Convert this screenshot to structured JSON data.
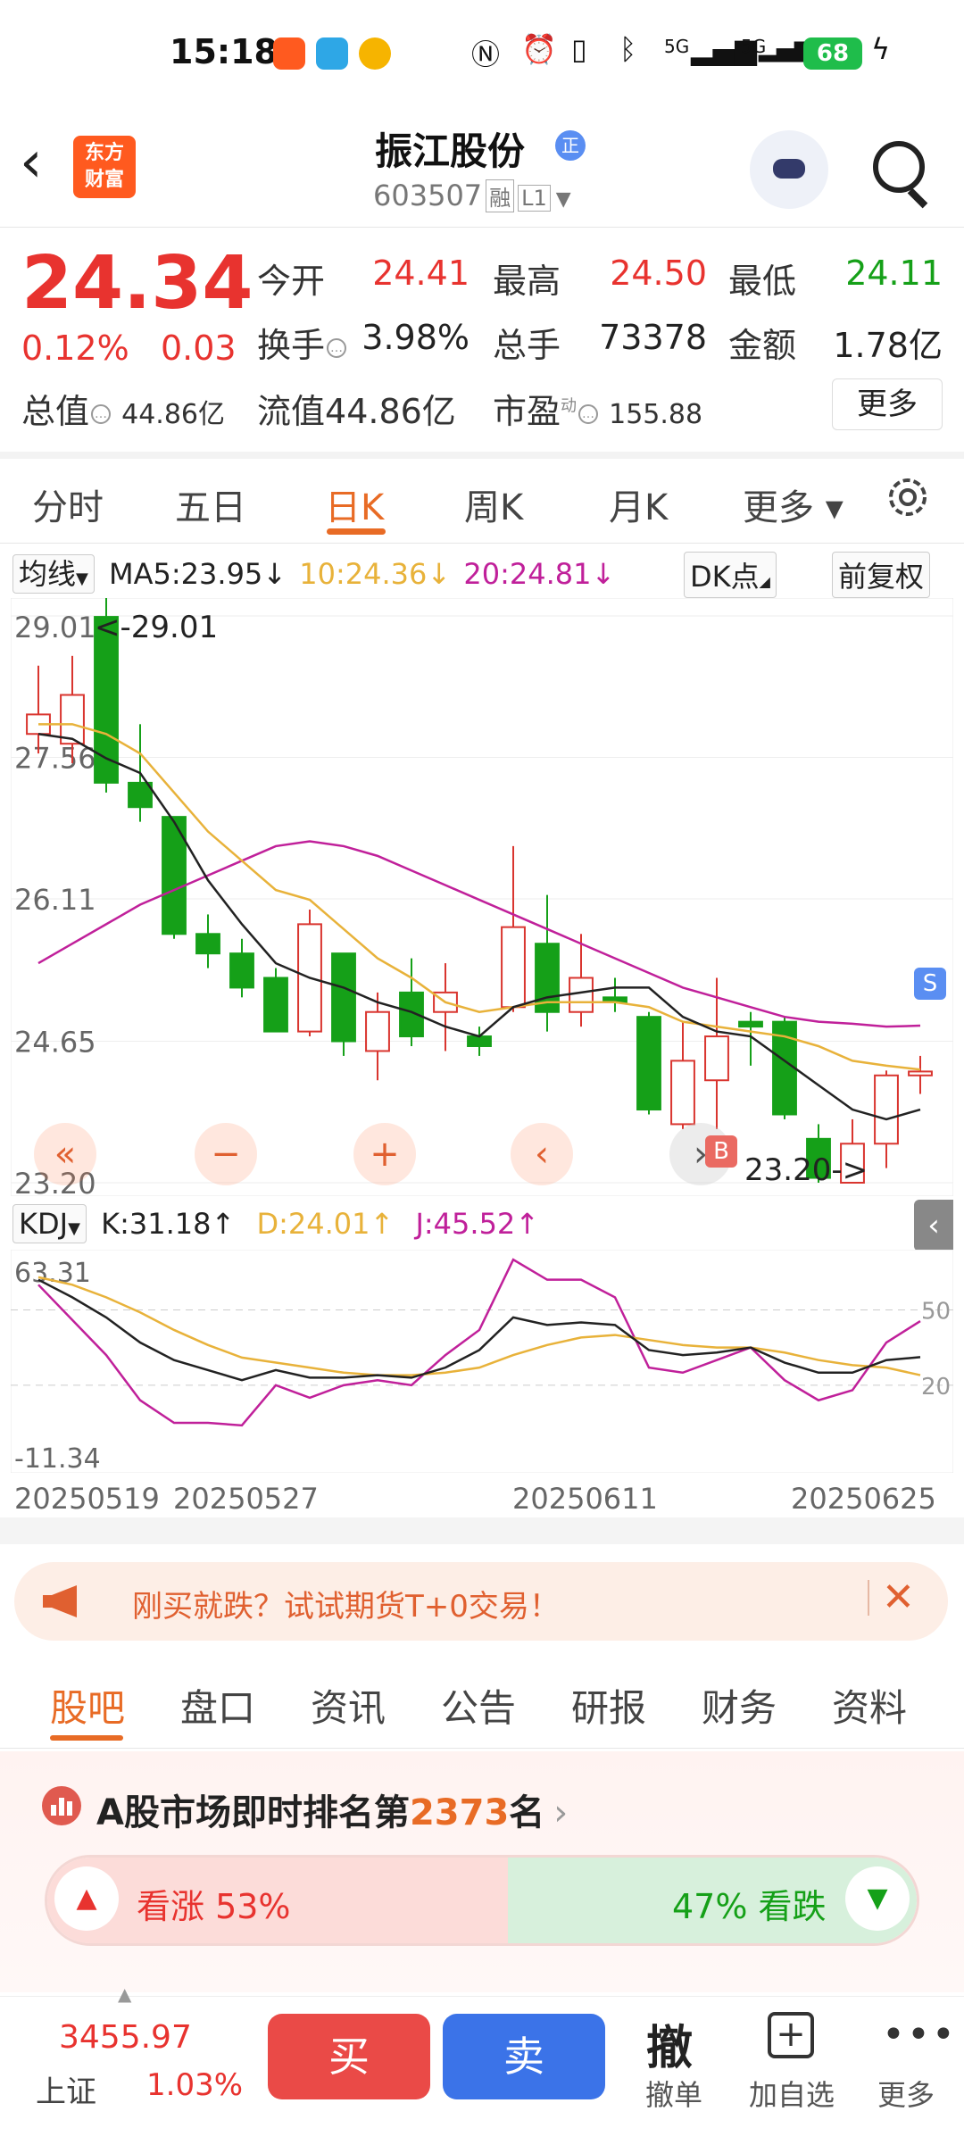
{
  "status_bar": {
    "time": "15:18",
    "battery": "68",
    "signal1": "5G",
    "signal2": "5G"
  },
  "header": {
    "stock_name": "振江股份",
    "name_badge": "正",
    "stock_code": "603507",
    "tag_margin": "融",
    "tag_level": "L1",
    "logo_line1": "东方",
    "logo_line2": "财富"
  },
  "quote": {
    "price": "24.34",
    "change_pct": "0.12%",
    "change_abs": "0.03",
    "open_label": "今开",
    "open": "24.41",
    "high_label": "最高",
    "high": "24.50",
    "low_label": "最低",
    "low": "24.11",
    "turnover_label": "换手",
    "turnover": "3.98%",
    "volume_label": "总手",
    "volume": "73378",
    "amount_label": "金额",
    "amount": "1.78亿",
    "mcap_label": "总值",
    "mcap": "44.86亿",
    "float_label": "流值",
    "float": "44.86亿",
    "pe_label": "市盈",
    "pe_sup": "动",
    "pe": "155.88",
    "more": "更多"
  },
  "period_tabs": [
    "分时",
    "五日",
    "日K",
    "周K",
    "月K",
    "更多"
  ],
  "ma_bar": {
    "selector": "均线",
    "ma5": "MA5:23.95↓",
    "ma10": "10:24.36↓",
    "ma20": "20:24.81↓",
    "dk": "DK点",
    "adjust": "前复权"
  },
  "kdj_bar": {
    "selector": "KDJ",
    "k": "K:31.18↑",
    "d": "D:24.01↑",
    "j": "J:45.52↑"
  },
  "colors": {
    "up": "#e8332f",
    "down": "#15a018",
    "ma5": "#222222",
    "ma10": "#e8b23a",
    "ma20": "#c0209a",
    "accent": "#e86b25"
  },
  "chart_data": {
    "type": "candlestick",
    "price_axis_labels": [
      "29.01",
      "27.56",
      "26.11",
      "24.65",
      "23.20"
    ],
    "kdj_axis_labels": [
      "63.31",
      "-11.34"
    ],
    "kdj_right_labels": [
      "50",
      "20"
    ],
    "high_marker": "<-29.01",
    "low_marker": "23.20->",
    "x_labels": [
      "20250519",
      "20250527",
      "20250611",
      "20250625"
    ],
    "ylim": [
      23.2,
      29.01
    ],
    "candles": [
      {
        "o": 27.8,
        "c": 28.0,
        "h": 28.5,
        "l": 27.6
      },
      {
        "o": 27.7,
        "c": 28.2,
        "h": 28.6,
        "l": 27.5
      },
      {
        "o": 29.0,
        "c": 27.3,
        "h": 29.2,
        "l": 27.2
      },
      {
        "o": 27.3,
        "c": 27.05,
        "h": 27.9,
        "l": 26.9
      },
      {
        "o": 26.95,
        "c": 25.75,
        "h": 26.95,
        "l": 25.7
      },
      {
        "o": 25.75,
        "c": 25.55,
        "h": 25.95,
        "l": 25.4
      },
      {
        "o": 25.55,
        "c": 25.2,
        "h": 25.7,
        "l": 25.1
      },
      {
        "o": 25.3,
        "c": 24.75,
        "h": 25.4,
        "l": 24.75
      },
      {
        "o": 24.75,
        "c": 25.85,
        "h": 26.0,
        "l": 24.7
      },
      {
        "o": 25.55,
        "c": 24.65,
        "h": 25.55,
        "l": 24.5
      },
      {
        "o": 24.55,
        "c": 24.95,
        "h": 25.15,
        "l": 24.25
      },
      {
        "o": 25.15,
        "c": 24.7,
        "h": 25.5,
        "l": 24.6
      },
      {
        "o": 24.95,
        "c": 25.15,
        "h": 25.45,
        "l": 24.55
      },
      {
        "o": 24.7,
        "c": 24.6,
        "h": 24.8,
        "l": 24.5
      },
      {
        "o": 25.0,
        "c": 25.82,
        "h": 26.65,
        "l": 24.95
      },
      {
        "o": 25.65,
        "c": 24.95,
        "h": 26.15,
        "l": 24.75
      },
      {
        "o": 24.95,
        "c": 25.3,
        "h": 25.75,
        "l": 24.8
      },
      {
        "o": 25.1,
        "c": 25.05,
        "h": 25.3,
        "l": 24.95
      },
      {
        "o": 24.9,
        "c": 23.95,
        "h": 24.95,
        "l": 23.9
      },
      {
        "o": 23.8,
        "c": 24.45,
        "h": 24.85,
        "l": 23.75
      },
      {
        "o": 24.25,
        "c": 24.7,
        "h": 25.3,
        "l": 23.75
      },
      {
        "o": 24.85,
        "c": 24.8,
        "h": 24.95,
        "l": 24.4
      },
      {
        "o": 24.85,
        "c": 23.9,
        "h": 24.9,
        "l": 23.85
      },
      {
        "o": 23.65,
        "c": 23.25,
        "h": 23.8,
        "l": 23.2
      },
      {
        "o": 23.2,
        "c": 23.6,
        "h": 23.85,
        "l": 23.2
      },
      {
        "o": 23.6,
        "c": 24.3,
        "h": 24.35,
        "l": 23.35
      },
      {
        "o": 24.3,
        "c": 24.34,
        "h": 24.5,
        "l": 24.11
      }
    ],
    "ma5": [
      27.8,
      27.75,
      27.55,
      27.4,
      26.9,
      26.3,
      25.85,
      25.45,
      25.3,
      25.2,
      25.05,
      24.95,
      24.8,
      24.7,
      25.0,
      25.1,
      25.15,
      25.2,
      25.2,
      24.9,
      24.75,
      24.7,
      24.45,
      24.2,
      23.95,
      23.85,
      23.95
    ],
    "ma10": [
      27.9,
      27.9,
      27.8,
      27.6,
      27.2,
      26.8,
      26.5,
      26.2,
      26.1,
      25.8,
      25.5,
      25.3,
      25.05,
      24.95,
      25.0,
      25.05,
      25.05,
      25.05,
      25.0,
      24.85,
      24.8,
      24.75,
      24.7,
      24.6,
      24.45,
      24.4,
      24.36
    ],
    "ma20": [
      25.45,
      25.65,
      25.85,
      26.05,
      26.2,
      26.35,
      26.5,
      26.65,
      26.7,
      26.65,
      26.55,
      26.4,
      26.25,
      26.1,
      25.95,
      25.8,
      25.65,
      25.5,
      25.35,
      25.2,
      25.1,
      25.0,
      24.9,
      24.85,
      24.83,
      24.8,
      24.81
    ],
    "kdj_ylim": [
      -11.34,
      63.31
    ],
    "K": [
      62,
      55,
      47,
      37,
      30,
      26,
      22,
      26,
      23,
      23,
      24,
      23,
      27,
      34,
      47,
      44,
      45,
      44,
      34,
      32,
      33,
      35,
      29,
      25,
      25,
      30,
      31.18
    ],
    "D": [
      63,
      60,
      55,
      49,
      42,
      36,
      31,
      29,
      27,
      25,
      24,
      24,
      25,
      27,
      32,
      36,
      39,
      40,
      38,
      36,
      35,
      35,
      33,
      30,
      28,
      27,
      24.01
    ],
    "J": [
      60,
      46,
      32,
      14,
      5,
      5,
      4,
      20,
      15,
      20,
      22,
      20,
      32,
      42,
      70,
      62,
      62,
      55,
      27,
      25,
      30,
      35,
      22,
      14,
      18,
      37,
      45.52
    ]
  },
  "banner": {
    "text": "刚买就跌？试试期货T+0交易！"
  },
  "lower_tabs": [
    "股吧",
    "盘口",
    "资讯",
    "公告",
    "研报",
    "财务",
    "资料"
  ],
  "rank": {
    "prefix": "A股市场即时排名第",
    "number": "2373",
    "suffix": "名"
  },
  "vote": {
    "up": "看涨 53%",
    "down": "47% 看跌",
    "up_pct": 53
  },
  "bottom_bar": {
    "index_value": "3455.97",
    "index_name": "上证",
    "index_change": "1.03%",
    "buy": "买",
    "sell": "卖",
    "cancel_glyph": "撤",
    "cancel_label": "撤单",
    "watch_label": "加自选",
    "more_label": "更多"
  }
}
